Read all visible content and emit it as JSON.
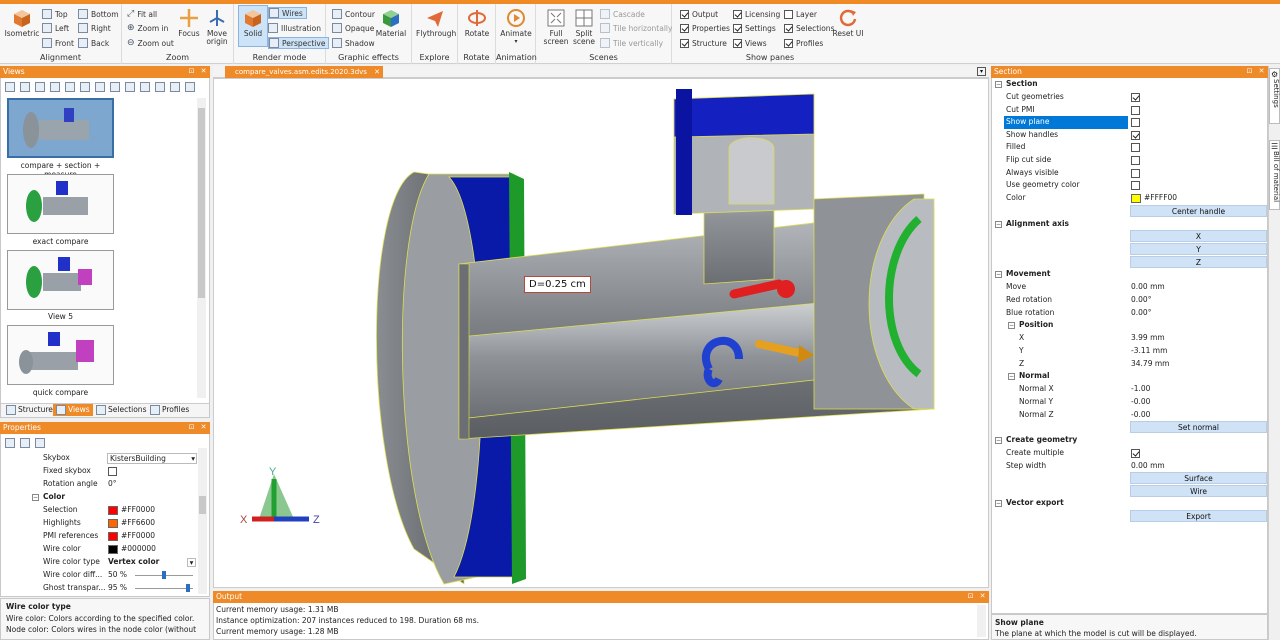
{
  "ribbon": {
    "alignment": {
      "label": "Alignment",
      "isometric": "Isometric",
      "top": "Top",
      "left": "Left",
      "front": "Front",
      "bottom": "Bottom",
      "right": "Right",
      "back": "Back"
    },
    "zoom": {
      "label": "Zoom",
      "fit_all": "Fit all",
      "zoom_in": "Zoom in",
      "zoom_out": "Zoom out",
      "focus": "Focus",
      "move_origin": "Move origin"
    },
    "render_mode": {
      "label": "Render mode",
      "solid": "Solid",
      "wires": "Wires",
      "illustration": "Illustration",
      "perspective": "Perspective"
    },
    "graphic_effects": {
      "label": "Graphic effects",
      "contour": "Contour",
      "opaque": "Opaque",
      "shadow": "Shadow",
      "material": "Material"
    },
    "explore": {
      "label": "Explore",
      "flythrough": "Flythrough"
    },
    "rotate": {
      "label": "Rotate",
      "rotate": "Rotate"
    },
    "animation": {
      "label": "Animation",
      "animate": "Animate"
    },
    "scenes": {
      "label": "Scenes",
      "full_screen": "Full screen",
      "split_scene": "Split scene",
      "cascade": "Cascade",
      "tile_h": "Tile horizontally",
      "tile_v": "Tile vertically"
    },
    "show_panes": {
      "label": "Show panes",
      "output": "Output",
      "properties": "Properties",
      "structure": "Structure",
      "licensing": "Licensing",
      "settings": "Settings",
      "views": "Views",
      "layer": "Layer",
      "selections": "Selections",
      "profiles": "Profiles",
      "reset_ui": "Reset UI"
    }
  },
  "views_panel": {
    "title": "Views",
    "items": [
      {
        "label": "compare + section + measure"
      },
      {
        "label": "exact compare"
      },
      {
        "label": "View 5"
      },
      {
        "label": "quick compare"
      }
    ],
    "tabs": [
      "Structure",
      "Views",
      "Selections",
      "Profiles"
    ]
  },
  "properties_panel": {
    "title": "Properties",
    "skybox": {
      "label": "Skybox",
      "value": "KistersBuilding"
    },
    "fixed_skybox": {
      "label": "Fixed skybox"
    },
    "rotation_angle": {
      "label": "Rotation angle",
      "value": "0°"
    },
    "color_cat": "Color",
    "selection": {
      "label": "Selection",
      "value": "#FF0000"
    },
    "highlights": {
      "label": "Highlights",
      "value": "#FF6600"
    },
    "pmi": {
      "label": "PMI references",
      "value": "#FF0000"
    },
    "wire_color": {
      "label": "Wire color",
      "value": "#000000"
    },
    "wire_color_type": {
      "label": "Wire color type",
      "value": "Vertex color"
    },
    "wire_color_diff": {
      "label": "Wire color diff...",
      "value": "50 %"
    },
    "ghost": {
      "label": "Ghost transpar...",
      "value": "95 %"
    },
    "help_title": "Wire color type",
    "help_text1": "Wire color: Colors according to the specified color.",
    "help_text2": "Node color: Colors wires in the node color (without"
  },
  "viewport": {
    "tab": "compare_valves.asm.edits.2020.3dvs",
    "measure": "D=0.25 cm"
  },
  "output_panel": {
    "title": "Output",
    "lines": [
      "Current memory usage: 1.31 MB",
      "Instance optimization: 207 instances reduced to 198. Duration 68 ms.",
      "Current memory usage: 1.28 MB"
    ]
  },
  "section_panel": {
    "title": "Section",
    "section_cat": "Section",
    "rows": [
      {
        "label": "Cut geometries",
        "checked": true
      },
      {
        "label": "Cut PMI",
        "checked": false
      },
      {
        "label": "Show plane",
        "checked": false
      },
      {
        "label": "Show handles",
        "checked": true
      },
      {
        "label": "Filled",
        "checked": false
      },
      {
        "label": "Flip cut side",
        "checked": false
      },
      {
        "label": "Always visible",
        "checked": false
      },
      {
        "label": "Use geometry color",
        "checked": false
      }
    ],
    "color": {
      "label": "Color",
      "value": "#FFFF00"
    },
    "center_handle": "Center handle",
    "alignment_cat": "Alignment axis",
    "x": "X",
    "y": "Y",
    "z": "Z",
    "movement_cat": "Movement",
    "move": {
      "label": "Move",
      "value": "0.00 mm"
    },
    "red_rot": {
      "label": "Red rotation",
      "value": "0.00°"
    },
    "blue_rot": {
      "label": "Blue rotation",
      "value": "0.00°"
    },
    "position_cat": "Position",
    "px": {
      "label": "X",
      "value": "3.99 mm"
    },
    "py": {
      "label": "Y",
      "value": "-3.11 mm"
    },
    "pz": {
      "label": "Z",
      "value": "34.79 mm"
    },
    "normal_cat": "Normal",
    "nx": {
      "label": "Normal X",
      "value": "-1.00"
    },
    "ny": {
      "label": "Normal Y",
      "value": "-0.00"
    },
    "nz": {
      "label": "Normal Z",
      "value": "-0.00"
    },
    "set_normal": "Set normal",
    "create_cat": "Create geometry",
    "create_multiple": {
      "label": "Create multiple",
      "checked": true
    },
    "step_width": {
      "label": "Step width",
      "value": "0.00 mm"
    },
    "surface": "Surface",
    "wire": "Wire",
    "vector_cat": "Vector export",
    "export": "Export",
    "help_title": "Show plane",
    "help_text": "The plane at which the model is cut will be displayed."
  },
  "side_tabs": [
    "Settings",
    "Bill of material"
  ],
  "colors": {
    "accent": "#EF8A28",
    "selection_hl": "#0078D7"
  }
}
